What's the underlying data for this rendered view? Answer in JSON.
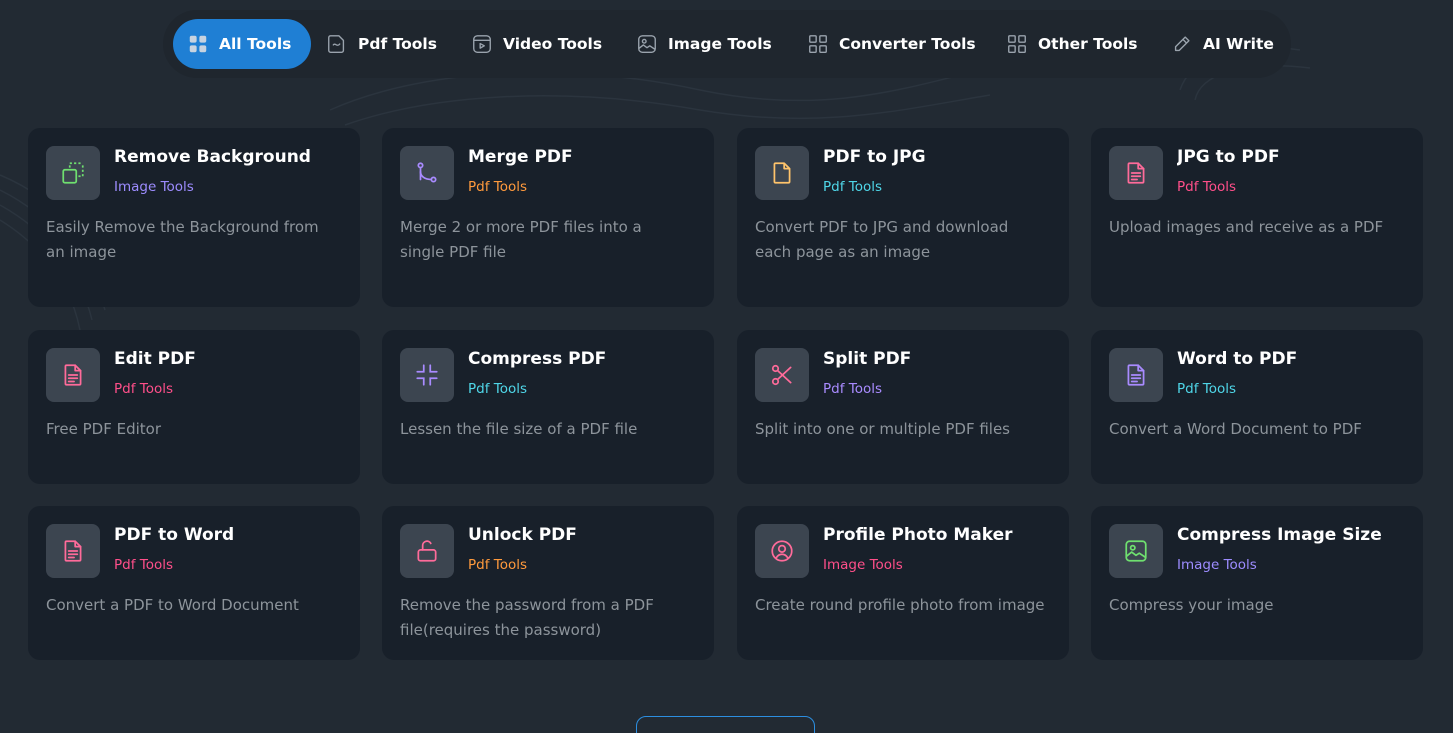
{
  "colors": {
    "background": "#222a33",
    "card": "#18202a",
    "accent": "#1f7fd4",
    "image_tools": "#9d8cff",
    "pdf_orange": "#ff9a3d",
    "pdf_pink": "#ff4f8a",
    "pdf_cyan": "#4fd6e8",
    "pdf_purple": "#a98bff",
    "description": "#8d949b"
  },
  "tabs": [
    {
      "label": "All Tools",
      "icon": "grid-dots-icon",
      "active": true
    },
    {
      "label": "Pdf Tools",
      "icon": "pdf-file-icon",
      "active": false
    },
    {
      "label": "Video Tools",
      "icon": "video-icon",
      "active": false
    },
    {
      "label": "Image Tools",
      "icon": "image-icon",
      "active": false
    },
    {
      "label": "Converter Tools",
      "icon": "grid-icon",
      "active": false
    },
    {
      "label": "Other Tools",
      "icon": "grid-icon",
      "active": false
    },
    {
      "label": "AI Write",
      "icon": "pencil-icon",
      "active": false
    }
  ],
  "tools": [
    {
      "title": "Remove Background",
      "category": "Image Tools",
      "category_color": "#9d8cff",
      "description": "Easily Remove the Background from an image",
      "icon": "remove-background-icon",
      "icon_color": "#6fe06f"
    },
    {
      "title": "Merge PDF",
      "category": "Pdf Tools",
      "category_color": "#ff9a3d",
      "description": "Merge 2 or more PDF files into a single PDF file",
      "icon": "merge-icon",
      "icon_color": "#a98bff"
    },
    {
      "title": "PDF to JPG",
      "category": "Pdf Tools",
      "category_color": "#4fd6e8",
      "description": "Convert PDF to JPG and download each page as an image",
      "icon": "file-icon",
      "icon_color": "#ffc46b"
    },
    {
      "title": "JPG to PDF",
      "category": "Pdf Tools",
      "category_color": "#ff4f8a",
      "description": "Upload images and receive as a PDF",
      "icon": "document-icon",
      "icon_color": "#ff6b9a"
    },
    {
      "title": "Edit PDF",
      "category": "Pdf Tools",
      "category_color": "#ff4f8a",
      "description": "Free PDF Editor",
      "icon": "document-icon",
      "icon_color": "#ff6b9a"
    },
    {
      "title": "Compress PDF",
      "category": "Pdf Tools",
      "category_color": "#4fd6e8",
      "description": "Lessen the file size of a PDF file",
      "icon": "compress-icon",
      "icon_color": "#a98bff"
    },
    {
      "title": "Split PDF",
      "category": "Pdf Tools",
      "category_color": "#a98bff",
      "description": "Split into one or multiple PDF files",
      "icon": "scissors-icon",
      "icon_color": "#ff6b9a"
    },
    {
      "title": "Word to PDF",
      "category": "Pdf Tools",
      "category_color": "#4fd6e8",
      "description": "Convert a Word Document to PDF",
      "icon": "document-icon",
      "icon_color": "#a98bff"
    },
    {
      "title": "PDF to Word",
      "category": "Pdf Tools",
      "category_color": "#ff4f8a",
      "description": "Convert a PDF to Word Document",
      "icon": "document-icon",
      "icon_color": "#ff6b9a"
    },
    {
      "title": "Unlock PDF",
      "category": "Pdf Tools",
      "category_color": "#ff9a3d",
      "description": "Remove the password from a PDF file(requires the password)",
      "icon": "unlock-icon",
      "icon_color": "#ff6b9a"
    },
    {
      "title": "Profile Photo Maker",
      "category": "Image Tools",
      "category_color": "#ff4f8a",
      "description": "Create round profile photo from image",
      "icon": "user-circle-icon",
      "icon_color": "#ff6b9a"
    },
    {
      "title": "Compress Image Size",
      "category": "Image Tools",
      "category_color": "#9d8cff",
      "description": "Compress your image",
      "icon": "image-icon",
      "icon_color": "#6fe06f"
    }
  ]
}
